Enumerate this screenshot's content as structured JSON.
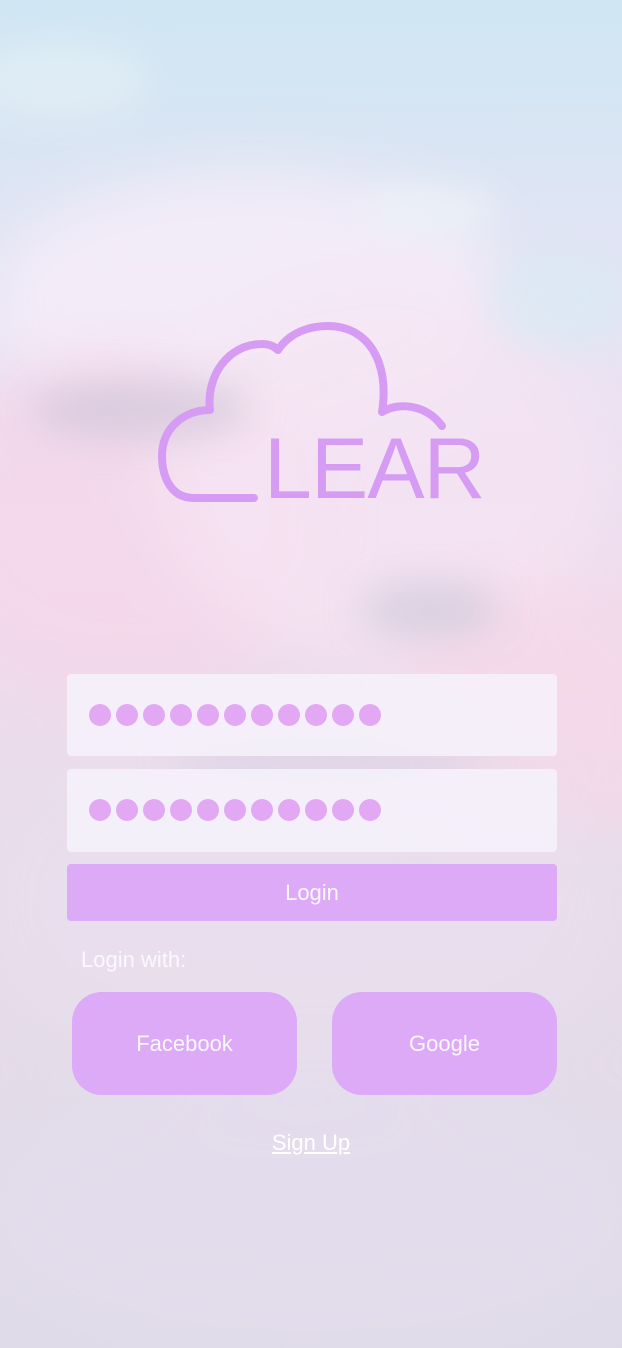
{
  "theme": {
    "accent": "#dcaaf6",
    "logo_color": "#d69cf3",
    "dot_color": "#e2a8f3"
  },
  "logo": {
    "icon": "cloud-icon",
    "letters": "LEAR"
  },
  "email_field": {
    "masked_dot_count": 11
  },
  "password_field": {
    "masked_dot_count": 11
  },
  "login_button": {
    "label": "Login"
  },
  "social": {
    "heading": "Login with:",
    "facebook_label": "Facebook",
    "google_label": "Google"
  },
  "signup_link": {
    "label": "Sign Up"
  }
}
